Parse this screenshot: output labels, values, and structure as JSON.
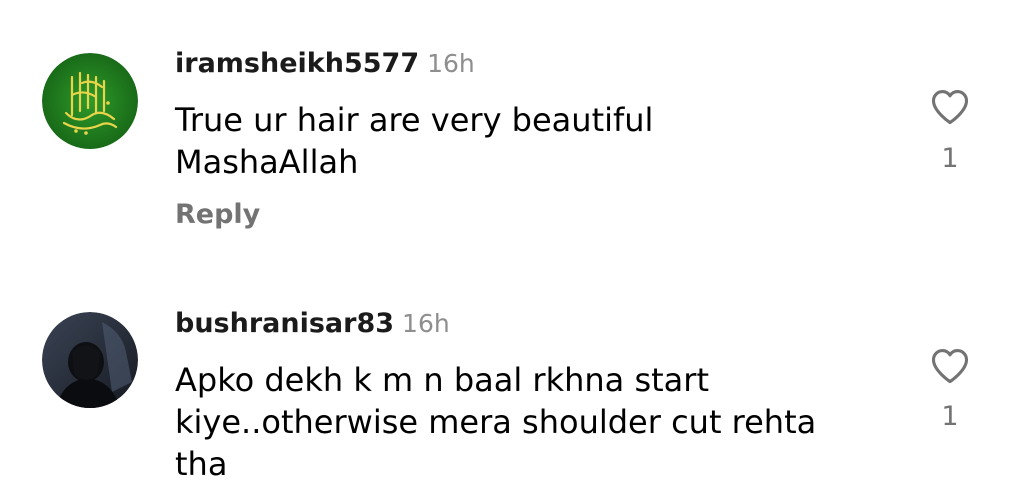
{
  "comments": [
    {
      "username": "iramsheikh5577",
      "time": "16h",
      "text_lines": [
        "True ur hair are very beautiful",
        "MashaAllah"
      ],
      "reply_label": "Reply",
      "likes": "1",
      "avatar": {
        "icon": "arabic-calligraphy-avatar",
        "bg": "#1f7a1f",
        "fg": "#e9d44a"
      }
    },
    {
      "username": "bushranisar83",
      "time": "16h",
      "text_lines": [
        "Apko dekh k m n baal rkhna start",
        "kiye..otherwise mera shoulder cut rehta",
        "tha"
      ],
      "likes": "1",
      "avatar": {
        "icon": "dark-portrait-avatar",
        "bg": "#2c3442",
        "fg": "#111111"
      }
    }
  ],
  "colors": {
    "username": "#1b1b1b",
    "secondary": "#737373",
    "time": "#8e8e8e",
    "heart_stroke": "#737373"
  },
  "icons": {
    "like": "heart-outline-icon"
  }
}
